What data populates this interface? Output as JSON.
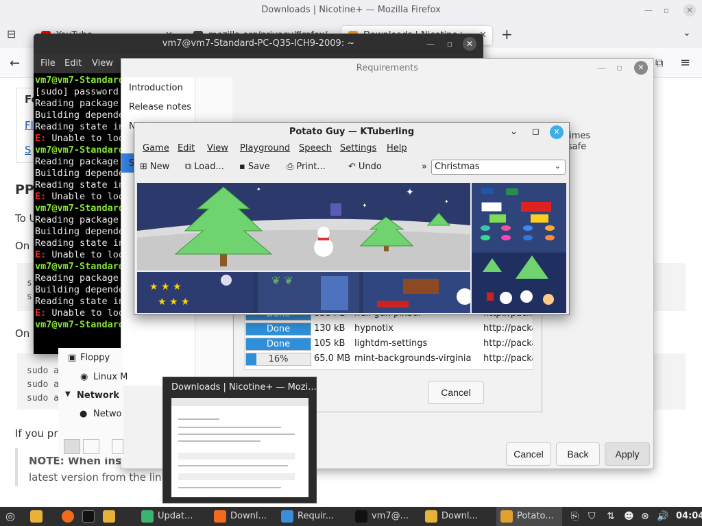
{
  "firefox": {
    "title": "Downloads | Nicotine+ — Mozilla Firefox",
    "tabs": [
      {
        "label": "YouTube",
        "color": "#ff0000"
      },
      {
        "label": "mozilla.org/privacy/firefox/",
        "color": "#444444"
      },
      {
        "label": "Downloads | Nicotine+",
        "color": "#f7a31c"
      }
    ],
    "new_tab": "+",
    "page": {
      "heading_partial": "PP",
      "lines": [
        "Fo",
        "Fl",
        "S",
        "To U",
        "On",
        "On",
        "If you pre",
        "NOTE: When insta",
        "latest version from the link a"
      ],
      "code1": [
        "s",
        "s"
      ],
      "code2": [
        "sudo a",
        "sudo a",
        "sudo a"
      ]
    }
  },
  "terminal": {
    "title": "vm7@vm7-Standard-PC-Q35-ICH9-2009: ~",
    "menu": [
      "File",
      "Edit",
      "View"
    ],
    "lines": [
      {
        "type": "prompt",
        "text": "vm7@vm7-Standard"
      },
      {
        "type": "normal",
        "text": "[sudo] password"
      },
      {
        "type": "normal",
        "text": "Reading package"
      },
      {
        "type": "normal",
        "text": "Building depende"
      },
      {
        "type": "normal",
        "text": "Reading state in"
      },
      {
        "type": "err",
        "prefix": "E:",
        "text": " Unable to loo"
      },
      {
        "type": "prompt",
        "text": "vm7@vm7-Standard"
      },
      {
        "type": "normal",
        "text": "Reading package"
      },
      {
        "type": "normal",
        "text": "Building depende"
      },
      {
        "type": "normal",
        "text": "Reading state in"
      },
      {
        "type": "err",
        "prefix": "E:",
        "text": " Unable to loo"
      },
      {
        "type": "prompt",
        "text": "vm7@vm7-Standard"
      },
      {
        "type": "normal",
        "text": "Reading package"
      },
      {
        "type": "normal",
        "text": "Building depende"
      },
      {
        "type": "normal",
        "text": "Reading state in"
      },
      {
        "type": "err",
        "prefix": "E:",
        "text": " Unable to loo"
      },
      {
        "type": "prompt",
        "text": "vm7@vm7-Standard"
      },
      {
        "type": "normal",
        "text": "Reading package"
      },
      {
        "type": "normal",
        "text": "Building depende"
      },
      {
        "type": "normal",
        "text": "Reading state in"
      },
      {
        "type": "err",
        "prefix": "E:",
        "text": " Unable to loo"
      },
      {
        "type": "prompt",
        "text": "vm7@vm7-Standard"
      }
    ]
  },
  "requirements": {
    "title": "Requirements",
    "nav": [
      "Introduction",
      "Release notes",
      "N",
      "R",
      "S"
    ],
    "right_text": [
      "etimes",
      "s safe"
    ],
    "buttons": {
      "cancel": "Cancel",
      "back": "Back",
      "apply": "Apply"
    },
    "fm_fragment": {
      "floppy": "Floppy",
      "linux": "Linux M",
      "network_header": "Network",
      "network_item": "Netwo"
    },
    "downloads": [
      {
        "status": "Done",
        "progress": 1.0,
        "size": "8384 B",
        "package": "heif-gdk-pixbuf",
        "url": "http://packa"
      },
      {
        "status": "Done",
        "progress": 1.0,
        "size": "130 kB",
        "package": "hypnotix",
        "url": "http://packa"
      },
      {
        "status": "Done",
        "progress": 1.0,
        "size": "105 kB",
        "package": "lightdm-settings",
        "url": "http://packa"
      },
      {
        "status": "16%",
        "progress": 0.16,
        "size": "65.0 MB",
        "package": "mint-backgrounds-virginia",
        "url": "http://packa"
      }
    ],
    "dialog_cancel": "Cancel"
  },
  "ktuberling": {
    "title": "Potato Guy — KTuberling",
    "menu": [
      "Game",
      "Edit",
      "View",
      "Playground",
      "Speech",
      "Settings",
      "Help"
    ],
    "toolbar": {
      "new": "New",
      "load": "Load...",
      "save": "Save",
      "print": "Print...",
      "undo": "Undo",
      "overflow": "»"
    },
    "playground": "Christmas"
  },
  "thumbnail": {
    "title": "Downloads | Nicotine+ — Mozi..."
  },
  "taskbar": {
    "items": [
      {
        "label": "Updat...",
        "color": "#3cb371"
      },
      {
        "label": "Downl...",
        "color": "#f26b1d"
      },
      {
        "label": "Requir...",
        "color": "#3b8fd9"
      },
      {
        "label": "vm7@...",
        "color": "#111111"
      },
      {
        "label": "Downl...",
        "color": "#e8b23a"
      },
      {
        "label": "Potato...",
        "color": "#e0a030"
      }
    ],
    "clock": "04:04"
  }
}
